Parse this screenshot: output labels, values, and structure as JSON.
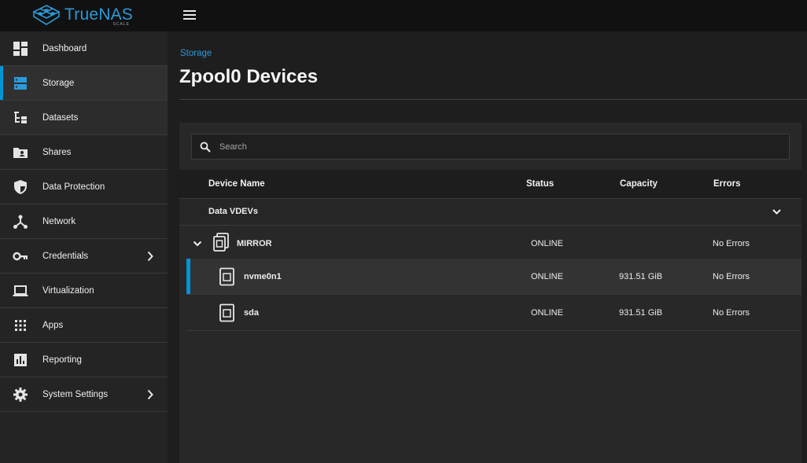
{
  "app": {
    "logo_text": "TrueNAS",
    "logo_sub": "SCALE"
  },
  "sidebar": {
    "items": [
      {
        "label": "Dashboard",
        "icon": "dashboard-icon"
      },
      {
        "label": "Storage",
        "icon": "storage-icon",
        "active": true
      },
      {
        "label": "Datasets",
        "icon": "datasets-icon"
      },
      {
        "label": "Shares",
        "icon": "shares-icon"
      },
      {
        "label": "Data Protection",
        "icon": "shield-icon"
      },
      {
        "label": "Network",
        "icon": "network-icon"
      },
      {
        "label": "Credentials",
        "icon": "key-icon",
        "has_submenu": true
      },
      {
        "label": "Virtualization",
        "icon": "laptop-icon"
      },
      {
        "label": "Apps",
        "icon": "apps-grid-icon"
      },
      {
        "label": "Reporting",
        "icon": "reporting-icon"
      },
      {
        "label": "System Settings",
        "icon": "gear-icon",
        "has_submenu": true
      }
    ]
  },
  "main": {
    "breadcrumb": "Storage",
    "title": "Zpool0 Devices"
  },
  "search": {
    "placeholder": "Search",
    "value": ""
  },
  "table": {
    "headers": {
      "name": "Device Name",
      "status": "Status",
      "capacity": "Capacity",
      "errors": "Errors"
    },
    "group": "Data VDEVs",
    "rows": [
      {
        "name": "MIRROR",
        "status": "ONLINE",
        "capacity": "",
        "errors": "No Errors"
      },
      {
        "name": "nvme0n1",
        "status": "ONLINE",
        "capacity": "931.51 GiB",
        "errors": "No Errors"
      },
      {
        "name": "sda",
        "status": "ONLINE",
        "capacity": "931.51 GiB",
        "errors": "No Errors"
      }
    ]
  },
  "colors": {
    "accent": "#0095d5",
    "brand": "#2b9ad9",
    "topbar": "#111111",
    "sidebar": "#242424"
  }
}
